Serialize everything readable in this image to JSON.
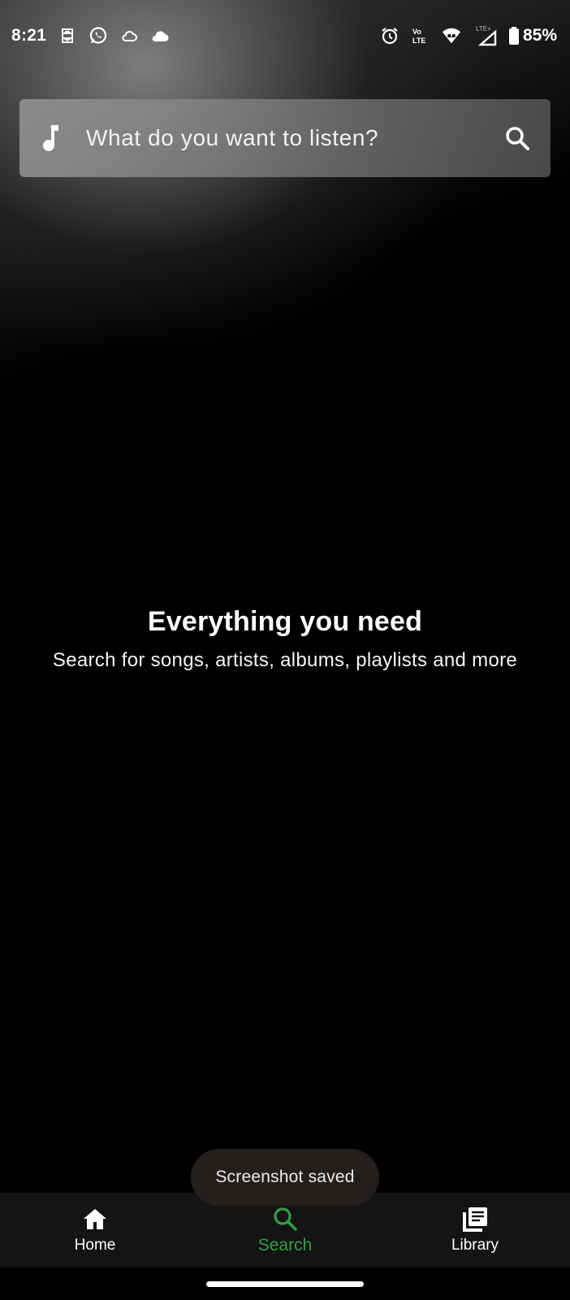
{
  "status_bar": {
    "time": "8:21",
    "battery": "85%",
    "left_icons": [
      "sim-icon",
      "whatsapp-icon",
      "cloud-outline-icon",
      "cloud-icon"
    ],
    "right_icons": [
      "alarm-icon",
      "volte-icon",
      "wifi-icon",
      "signal-icon",
      "battery-icon"
    ],
    "volte_label": "Vo LTE",
    "lte_label": "LTE+"
  },
  "search": {
    "placeholder": "What do you want to listen?",
    "leading_icon": "music-note-icon",
    "trailing_icon": "search-icon"
  },
  "empty_state": {
    "title": "Everything you need",
    "subtitle": "Search for songs, artists, albums, playlists and more"
  },
  "toast": {
    "text": "Screenshot saved"
  },
  "bottom_nav": {
    "items": [
      {
        "label": "Home",
        "icon": "home-icon",
        "active": false
      },
      {
        "label": "Search",
        "icon": "search-icon",
        "active": true
      },
      {
        "label": "Library",
        "icon": "library-icon",
        "active": false
      }
    ],
    "active_color": "#2f9e45"
  }
}
